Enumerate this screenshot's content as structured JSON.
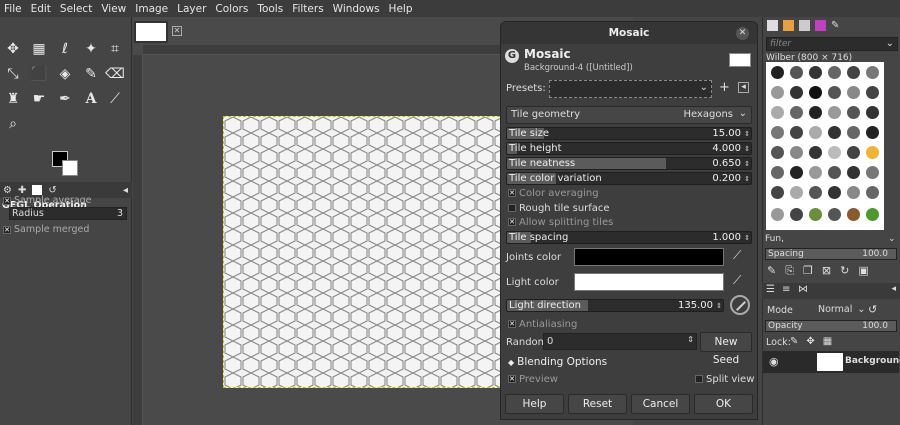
{
  "menu": [
    "File",
    "Edit",
    "Select",
    "View",
    "Image",
    "Layer",
    "Colors",
    "Tools",
    "Filters",
    "Windows",
    "Help"
  ],
  "toolbox": {
    "tools": [
      "move-icon",
      "rect-select-icon",
      "lasso-icon",
      "fuzzy-select-icon",
      "crop-icon",
      "transform-icon",
      "warp-icon",
      "bucket-icon",
      "paintbrush-icon",
      "eraser-icon",
      "clone-icon",
      "smudge-icon",
      "path-icon",
      "text-icon",
      "color-picker-icon",
      "zoom-icon"
    ],
    "options_title": "GEGL Operation",
    "sample_average": "Sample average",
    "radius_label": "Radius",
    "radius_value": "3",
    "sample_merged": "Sample merged"
  },
  "dialog": {
    "window_title": "Mosaic",
    "header_title": "Mosaic",
    "header_subtitle": "Background-4 ([Untitled])",
    "presets_label": "Presets:",
    "tile_geometry_label": "Tile geometry",
    "tile_geometry_value": "Hexagons",
    "sliders": [
      {
        "label": "Tile size",
        "value": "15.00",
        "fill": 0.15
      },
      {
        "label": "Tile height",
        "value": "4.000",
        "fill": 0.04
      },
      {
        "label": "Tile neatness",
        "value": "0.650",
        "fill": 0.65
      },
      {
        "label": "Tile color variation",
        "value": "0.200",
        "fill": 0.2
      }
    ],
    "color_averaging": "Color averaging",
    "rough_tile_surface": "Rough tile surface",
    "allow_splitting": "Allow splitting tiles",
    "tile_spacing_label": "Tile spacing",
    "tile_spacing_value": "1.000",
    "tile_spacing_fill": 0.1,
    "joints_color_label": "Joints color",
    "joints_color": "#000000",
    "light_color_label": "Light color",
    "light_color": "#ffffff",
    "light_direction_label": "Light direction",
    "light_direction_value": "135.00",
    "light_direction_fill": 0.375,
    "antialiasing": "Antialiasing",
    "random_seed_label": "Random seed",
    "random_seed_value": "0",
    "new_seed": "New Seed",
    "blending_options": "Blending Options",
    "preview": "Preview",
    "split_view": "Split view",
    "buttons": {
      "help": "Help",
      "reset": "Reset",
      "cancel": "Cancel",
      "ok": "OK"
    }
  },
  "right_panel": {
    "filter_placeholder": "filter",
    "brush_name": "Wilber (800 × 716)",
    "brush_set": "Fun,",
    "spacing_label": "Spacing",
    "spacing_value": "100.0",
    "mode_label": "Mode",
    "mode_value": "Normal",
    "opacity_label": "Opacity",
    "opacity_value": "100.0",
    "lock_label": "Lock:",
    "layer_name": "Background"
  }
}
